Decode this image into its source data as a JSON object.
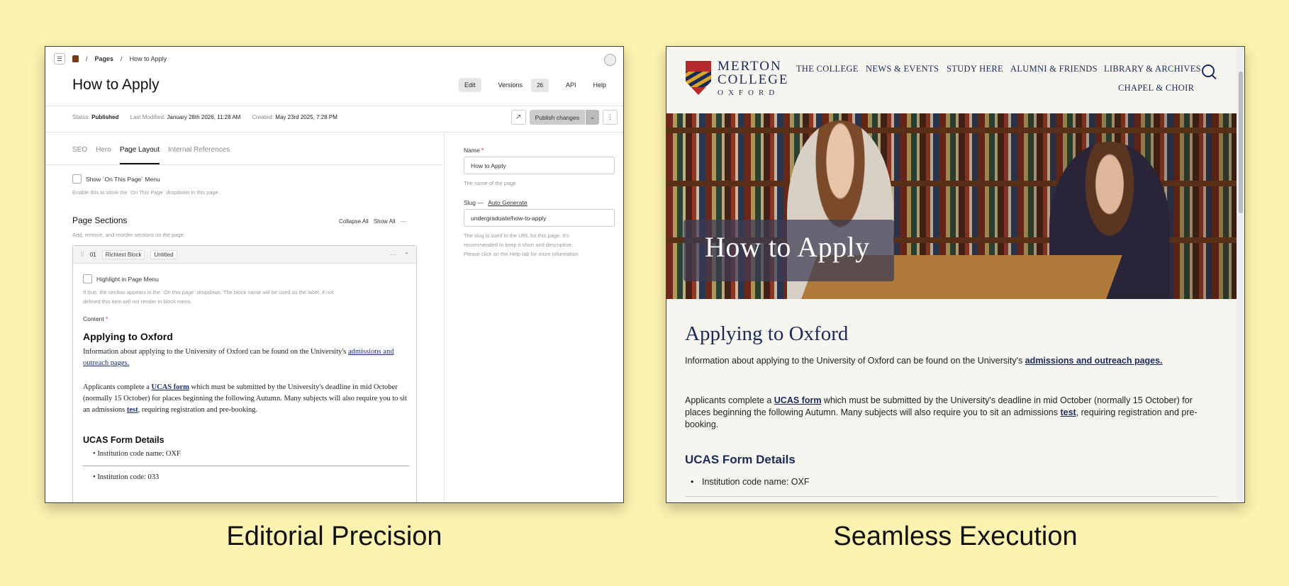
{
  "cms": {
    "breadcrumb": {
      "section": "Pages",
      "sep1": "/",
      "sep2": "/",
      "page": "How to Apply"
    },
    "title": "How to Apply",
    "actions": {
      "edit": "Edit",
      "versions": "Versions",
      "versions_count": "26",
      "api": "API",
      "help": "Help"
    },
    "meta": {
      "status_label": "Status:",
      "status_value": "Published",
      "modified_label": "Last Modified:",
      "modified_value": "January 28th 2026, 11:28 AM",
      "created_label": "Created:",
      "created_value": "May 23rd 2025, 7:28 PM"
    },
    "publish_label": "Publish changes",
    "tabs": [
      "SEO",
      "Hero",
      "Page Layout",
      "Internal References"
    ],
    "on_this_page": {
      "label": "Show `On This Page` Menu",
      "hint": "Enable this to show the `On This Page` dropdown in this page."
    },
    "sections": {
      "title": "Page Sections",
      "subtitle": "Add, remove, and reorder sections on the page.",
      "collapse_all": "Collapse All",
      "show_all": "Show All"
    },
    "block": {
      "index": "01",
      "type": "Richtext Block",
      "name": "Untitled",
      "highlight_label": "Highlight in Page Menu",
      "highlight_hint_1": "If true, the section appears in the `On this page` dropdown. The block name will be used as the label, if not",
      "highlight_hint_2": "defined this item will not render in block menu.",
      "content_label": "Content",
      "heading": "Applying to Oxford",
      "p1_text": "Information about applying to the University of Oxford can be found on the University's",
      "p1_link": "admissions and outreach pages.",
      "p2_a": "Applicants complete a ",
      "p2_link1": "UCAS form",
      "p2_b": " which must be submitted by the University's deadline in mid October (normally 15 October) for places beginning the following Autumn.  Many subjects will also require you to sit an admissions ",
      "p2_link2": "test",
      "p2_c": ", requiring registration and pre-booking.",
      "h2": "UCAS Form Details",
      "li1": "Institution code name: OXF",
      "li2": "Institution code: 033"
    },
    "side": {
      "name_label": "Name",
      "name_value": "How to Apply",
      "name_hint": "The name of the page",
      "slug_label": "Slug",
      "slug_dash": "—",
      "slug_auto": "Auto Generate",
      "slug_value": "undergraduate/how-to-apply",
      "slug_hint_1": "The slug is used in the URL for this page. It's",
      "slug_hint_2": "recommended to keep it short and descriptive.",
      "slug_hint_3": "Please click on the Help tab for more information"
    }
  },
  "site": {
    "college_line1": "MERTON",
    "college_line2": "COLLEGE",
    "college_line3": "OXFORD",
    "nav": [
      "THE COLLEGE",
      "NEWS & EVENTS",
      "STUDY HERE",
      "ALUMNI & FRIENDS",
      "LIBRARY & ARCHIVES",
      "CHAPEL & CHOIR"
    ],
    "hero_title": "How to Apply",
    "h1": "Applying to Oxford",
    "p1_text": "Information about applying to the University of Oxford can be found on the University's ",
    "p1_link": "admissions and outreach pages.",
    "p2_a": "Applicants complete a ",
    "p2_link1": "UCAS form",
    "p2_b": " which must be submitted by the University's deadline in mid October (normally 15 October) for places beginning the following Autumn.  Many subjects will also require you to sit an admissions ",
    "p2_link2": "test",
    "p2_c": ", requiring registration and pre-booking.",
    "h2": "UCAS Form Details",
    "li1": "Institution code name: OXF"
  },
  "captions": {
    "left": "Editorial Precision",
    "right": "Seamless Execution"
  },
  "colors": {
    "background": "#fdf3b0",
    "brand_navy": "#1c2a5a",
    "brand_red": "#b52a2a",
    "brand_gold": "#d9a42b"
  }
}
